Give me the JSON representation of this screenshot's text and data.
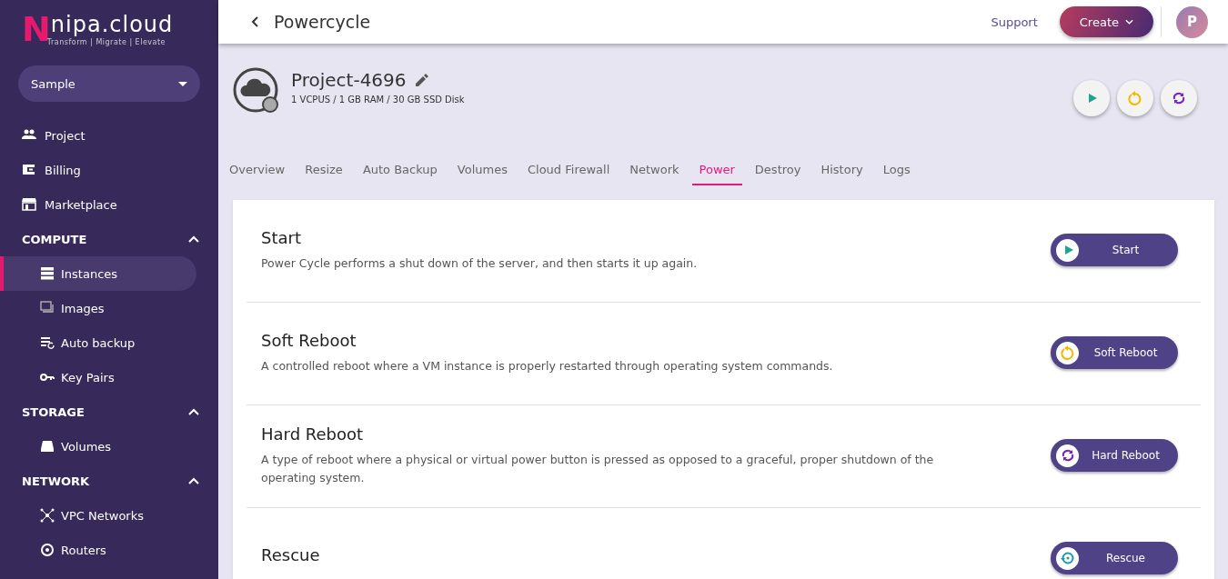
{
  "logo": {
    "name": "nipa.cloud",
    "letter": "N",
    "tagline": "Transform | Migrate | Elevate"
  },
  "project_select": {
    "value": "Sample"
  },
  "sidebar": {
    "items": [
      {
        "kind": "link",
        "label": "Project",
        "selected": false
      },
      {
        "kind": "link",
        "label": "Billing",
        "selected": false
      },
      {
        "kind": "link",
        "label": "Marketplace",
        "selected": false
      },
      {
        "kind": "section",
        "label": "COMPUTE",
        "expanded": true
      },
      {
        "kind": "sub",
        "label": "Instances",
        "selected": true
      },
      {
        "kind": "sub",
        "label": "Images",
        "selected": false
      },
      {
        "kind": "sub",
        "label": "Auto backup",
        "selected": false
      },
      {
        "kind": "sub",
        "label": "Key Pairs",
        "selected": false
      },
      {
        "kind": "section",
        "label": "STORAGE",
        "expanded": true
      },
      {
        "kind": "sub",
        "label": "Volumes",
        "selected": false
      },
      {
        "kind": "section",
        "label": "NETWORK",
        "expanded": true
      },
      {
        "kind": "sub",
        "label": "VPC Networks",
        "selected": false
      },
      {
        "kind": "sub",
        "label": "Routers",
        "selected": false
      }
    ]
  },
  "header": {
    "title": "Powercycle",
    "support": "Support",
    "create": "Create",
    "avatar": "P"
  },
  "instance": {
    "name": "Project-4696",
    "specs": "1 VCPUS / 1 GB RAM / 30 GB SSD Disk"
  },
  "quick_actions": [
    {
      "kind": "start"
    },
    {
      "kind": "soft"
    },
    {
      "kind": "hard"
    }
  ],
  "tabs": [
    {
      "label": "Overview",
      "selected": false
    },
    {
      "label": "Resize",
      "selected": false
    },
    {
      "label": "Auto Backup",
      "selected": false
    },
    {
      "label": "Volumes",
      "selected": false
    },
    {
      "label": "Cloud Firewall",
      "selected": false
    },
    {
      "label": "Network",
      "selected": false
    },
    {
      "label": "Power",
      "selected": true
    },
    {
      "label": "Destroy",
      "selected": false
    },
    {
      "label": "History",
      "selected": false
    },
    {
      "label": "Logs",
      "selected": false
    }
  ],
  "actions": [
    {
      "kind": "start",
      "title": "Start",
      "description": "Power Cycle performs a shut down of the server, and then starts it up again.",
      "button": "Start"
    },
    {
      "kind": "soft",
      "title": "Soft Reboot",
      "description": "A controlled reboot where a VM instance is properly restarted through operating system commands.",
      "button": "Soft Reboot"
    },
    {
      "kind": "hard",
      "title": "Hard Reboot",
      "description": "A type of reboot where a physical or virtual power button is pressed as opposed to a graceful, proper shutdown of the operating system.",
      "button": "Hard Reboot"
    },
    {
      "kind": "rescue",
      "title": "Rescue",
      "button": "Rescue"
    }
  ]
}
